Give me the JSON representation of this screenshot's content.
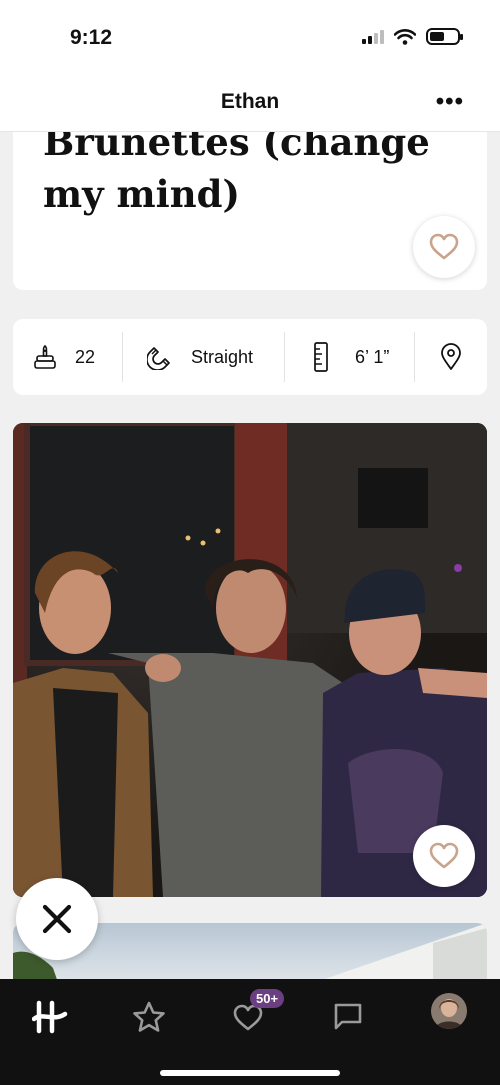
{
  "status_bar": {
    "time": "9:12"
  },
  "header": {
    "title": "Ethan",
    "more_label": "•••"
  },
  "prompt": {
    "answer": "Brunettes (change my mind)"
  },
  "info": {
    "age": "22",
    "sexuality": "Straight",
    "height": "6’ 1”"
  },
  "icons": {
    "like": "heart-icon",
    "dislike": "x-icon",
    "age": "cake-icon",
    "sexuality": "magnet-icon",
    "height": "ruler-icon",
    "location": "location-pin-icon"
  },
  "nav": {
    "items": [
      "home",
      "standouts",
      "likes-you",
      "matches",
      "profile"
    ],
    "likes_badge": "50+"
  },
  "colors": {
    "background": "#f0f0f0",
    "card": "#ffffff",
    "heart": "#c9a48c",
    "nav_bg": "#111111",
    "badge": "#6c3f82"
  }
}
